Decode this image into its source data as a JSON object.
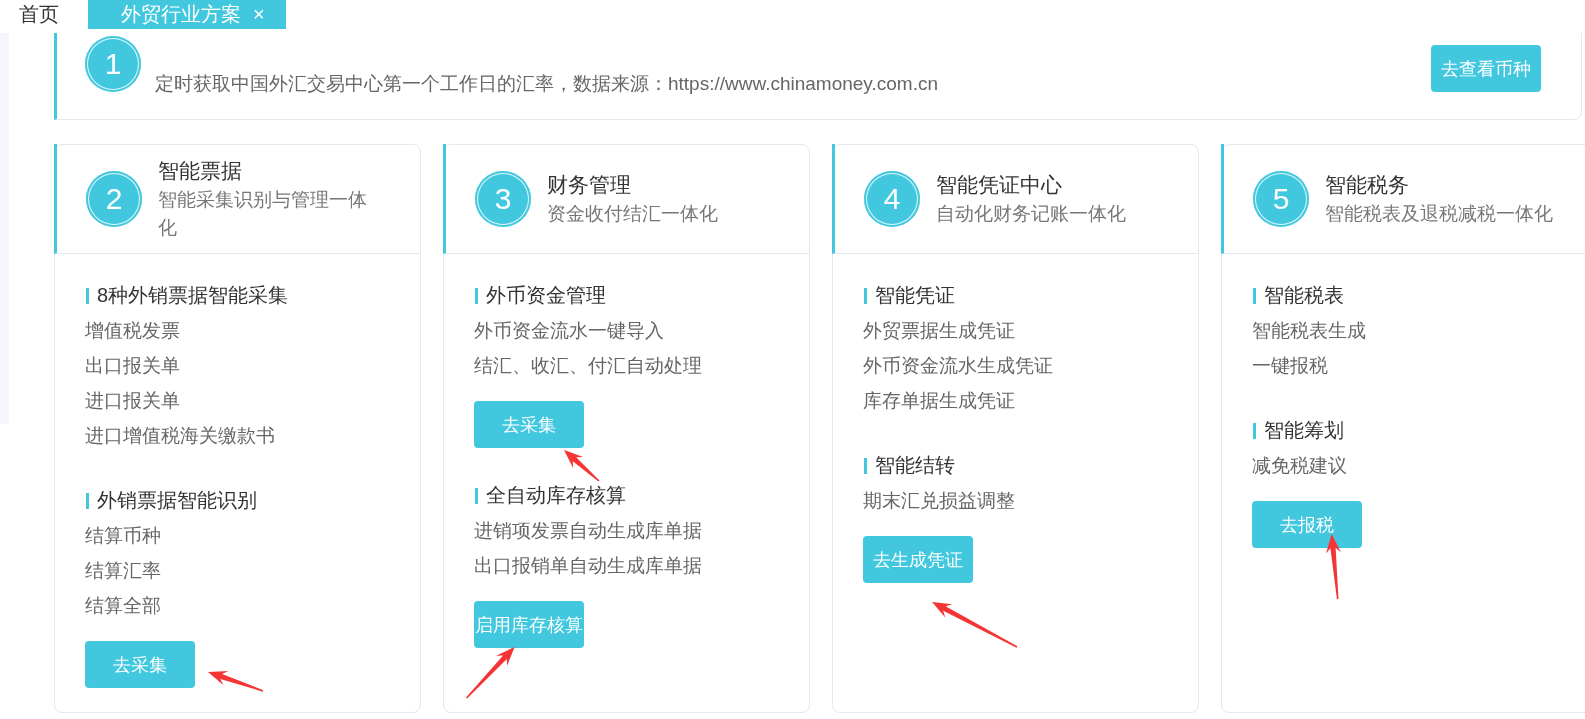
{
  "tabs": [
    {
      "label": "首页",
      "selected": false
    },
    {
      "label": "外贸行业方案",
      "selected": true,
      "close": "×"
    }
  ],
  "intro": {
    "number": "1",
    "description": "定时获取中国外汇交易中心第一个工作日的汇率，数据来源：https://www.chinamoney.com.cn",
    "button": "去查看币种"
  },
  "cards": [
    {
      "number": "2",
      "title": "智能票据",
      "subtitle": "智能采集识别与管理一体化",
      "sections": [
        {
          "title": "8种外销票据智能采集",
          "items": [
            "增值税发票",
            "出口报关单",
            "进口报关单",
            "进口增值税海关缴款书"
          ]
        },
        {
          "title": "外销票据智能识别",
          "items": [
            "结算币种",
            "结算汇率",
            "结算全部"
          ],
          "button": "去采集"
        }
      ]
    },
    {
      "number": "3",
      "title": "财务管理",
      "subtitle": "资金收付结汇一体化",
      "sections": [
        {
          "title": "外币资金管理",
          "items": [
            "外币资金流水一键导入",
            "结汇、收汇、付汇自动处理"
          ],
          "button": "去采集"
        },
        {
          "title": "全自动库存核算",
          "items": [
            "进销项发票自动生成库单据",
            "出口报销单自动生成库单据"
          ],
          "button": "启用库存核算"
        }
      ]
    },
    {
      "number": "4",
      "title": "智能凭证中心",
      "subtitle": "自动化财务记账一体化",
      "sections": [
        {
          "title": "智能凭证",
          "items": [
            "外贸票据生成凭证",
            "外币资金流水生成凭证",
            "库存单据生成凭证"
          ]
        },
        {
          "title": "智能结转",
          "items": [
            "期末汇兑损益调整"
          ],
          "button": "去生成凭证"
        }
      ]
    },
    {
      "number": "5",
      "title": "智能税务",
      "subtitle": "智能税表及退税减税一体化",
      "sections": [
        {
          "title": "智能税表",
          "items": [
            "智能税表生成",
            "一键报税"
          ]
        },
        {
          "title": "智能筹划",
          "items": [
            "减免税建议"
          ],
          "button": "去报税"
        }
      ]
    }
  ]
}
